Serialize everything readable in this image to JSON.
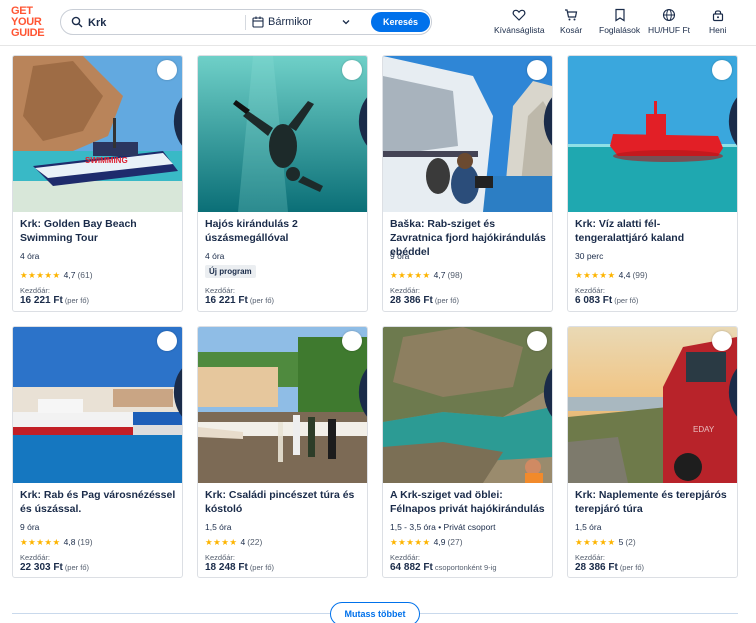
{
  "header": {
    "logo": [
      "GET",
      "YOUR",
      "GUIDE"
    ],
    "search_value": "Krk",
    "date_label": "Bármikor",
    "search_button": "Keresés",
    "nav": {
      "wishlist": "Kívánságlista",
      "cart": "Kosár",
      "bookings": "Foglalások",
      "currency": "HU/HUF Ft",
      "profile": "Heni"
    }
  },
  "colors": {
    "accent": "#0071eb",
    "brand": "#ff5533",
    "star": "#fdb400"
  },
  "cards": [
    {
      "title": "Krk: Golden Bay Beach Swimming Tour",
      "duration": "4 óra",
      "badge": "",
      "stars": "★★★★★",
      "rating": "4,7",
      "count": "(61)",
      "from": "Kezdőár:",
      "price": "16 221 Ft",
      "per": "(per fő)",
      "image": "boat-beach"
    },
    {
      "title": "Hajós kirándulás 2 úszásmegállóval",
      "duration": "4 óra",
      "badge": "Új program",
      "stars": "",
      "rating": "",
      "count": "",
      "from": "Kezdőár:",
      "price": "16 221 Ft",
      "per": "(per fő)",
      "image": "underwater-swimmer"
    },
    {
      "title": "Baška: Rab-sziget és Zavratnica fjord hajókirándulás ebéddel",
      "duration": "9 óra",
      "badge": "",
      "stars": "★★★★★",
      "rating": "4,7",
      "count": "(98)",
      "from": "Kezdőár:",
      "price": "28 386 Ft",
      "per": "(per fő)",
      "image": "boat-deck-cliff"
    },
    {
      "title": "Krk: Víz alatti fél-tengeralattjáró kaland",
      "duration": "30 perc",
      "badge": "",
      "stars": "★★★★★",
      "rating": "4,4",
      "count": "(99)",
      "from": "Kezdőár:",
      "price": "6 083 Ft",
      "per": "(per fő)",
      "image": "red-submarine"
    },
    {
      "title": "Krk: Rab és Pag városnézéssel és úszással.",
      "duration": "9 óra",
      "badge": "",
      "stars": "★★★★★",
      "rating": "4,8",
      "count": "(19)",
      "from": "Kezdőár:",
      "price": "22 303 Ft",
      "per": "(per fő)",
      "image": "ferry-town"
    },
    {
      "title": "Krk: Családi pincészet túra és kóstoló",
      "duration": "1,5 óra",
      "badge": "",
      "stars": "★★★★",
      "rating": "4",
      "count": "(22)",
      "from": "Kezdőár:",
      "price": "18 248 Ft",
      "per": "(per fő)",
      "image": "wine-table"
    },
    {
      "title": "A Krk-sziget vad öblei: Félnapos privát hajókirándulás",
      "duration": "1,5 - 3,5 óra • Privát csoport",
      "badge": "",
      "stars": "★★★★★",
      "rating": "4,9",
      "count": "(27)",
      "from": "Kezdőár:",
      "price": "64 882 Ft",
      "per": "csoportonként 9-ig",
      "image": "wild-bay"
    },
    {
      "title": "Krk: Naplemente és terepjárós terepjáró túra",
      "duration": "1,5 óra",
      "badge": "",
      "stars": "★★★★★",
      "rating": "5",
      "count": "(2)",
      "from": "Kezdőár:",
      "price": "28 386 Ft",
      "per": "(per fő)",
      "image": "jeep-sunset"
    }
  ],
  "show_more": "Mutass többet"
}
